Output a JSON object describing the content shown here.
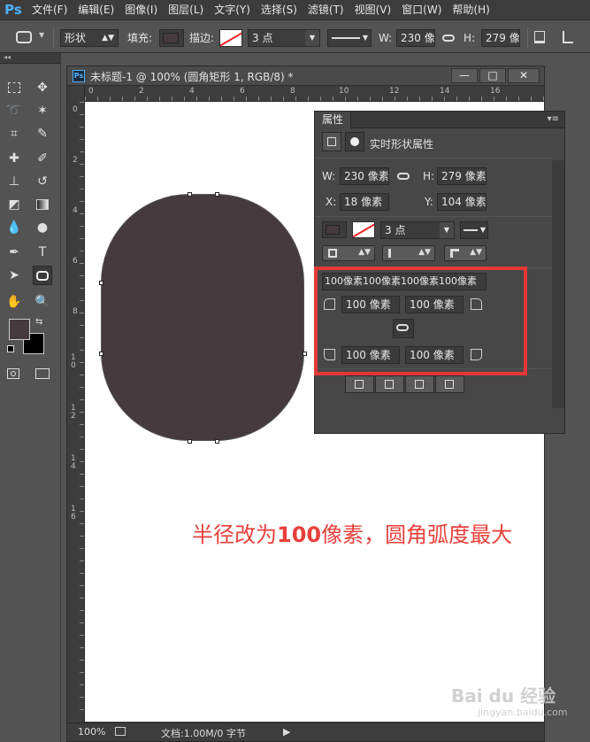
{
  "app": {
    "logo": "Ps"
  },
  "menu": [
    "文件(F)",
    "编辑(E)",
    "图像(I)",
    "图层(L)",
    "文字(Y)",
    "选择(S)",
    "滤镜(T)",
    "视图(V)",
    "窗口(W)",
    "帮助(H)"
  ],
  "options": {
    "mode": "形状",
    "fill_label": "填充:",
    "stroke_label": "描边:",
    "stroke_size": "3 点",
    "w_label": "W:",
    "w_value": "230 像",
    "h_label": "H:",
    "h_value": "279 像"
  },
  "document": {
    "badge": "Ps",
    "title": "未标题-1 @ 100% (圆角矩形 1, RGB/8) *",
    "min": "—",
    "max": "□",
    "close": "✕",
    "ruler_top": [
      "0",
      "2",
      "4",
      "6",
      "8",
      "10",
      "12",
      "14",
      "16"
    ],
    "ruler_left": [
      "0",
      "2",
      "4",
      "6",
      "8",
      "1 0",
      "1 2",
      "1 4",
      "1 6"
    ],
    "zoom": "100%",
    "doc_info": "文档:1.00M/0 字节",
    "status_arrow": "▶"
  },
  "shape": {
    "color": "#453a3d"
  },
  "properties": {
    "tab": "属性",
    "header": "实时形状属性",
    "w_label": "W:",
    "w_value": "230 像素",
    "h_label": "H:",
    "h_value": "279 像素",
    "x_label": "X:",
    "x_value": "18 像素",
    "y_label": "Y:",
    "y_value": "104 像素",
    "stroke_size": "3 点",
    "radii_all": "100像素100像素100像素100像素",
    "r_top_left": "100 像素",
    "r_top_right": "100 像素",
    "r_bottom_left": "100 像素",
    "r_bottom_right": "100 像素"
  },
  "caption": {
    "prefix": "半径改为",
    "number": "100",
    "suffix": "像素，圆角弧度最大"
  },
  "watermark": {
    "brand": "Bai du 经验",
    "url": "jingyan.baidu.com"
  },
  "colors": {
    "highlight": "#e53935",
    "caption": "#e8403c",
    "foreground": "#453a3d",
    "background": "#000000"
  }
}
